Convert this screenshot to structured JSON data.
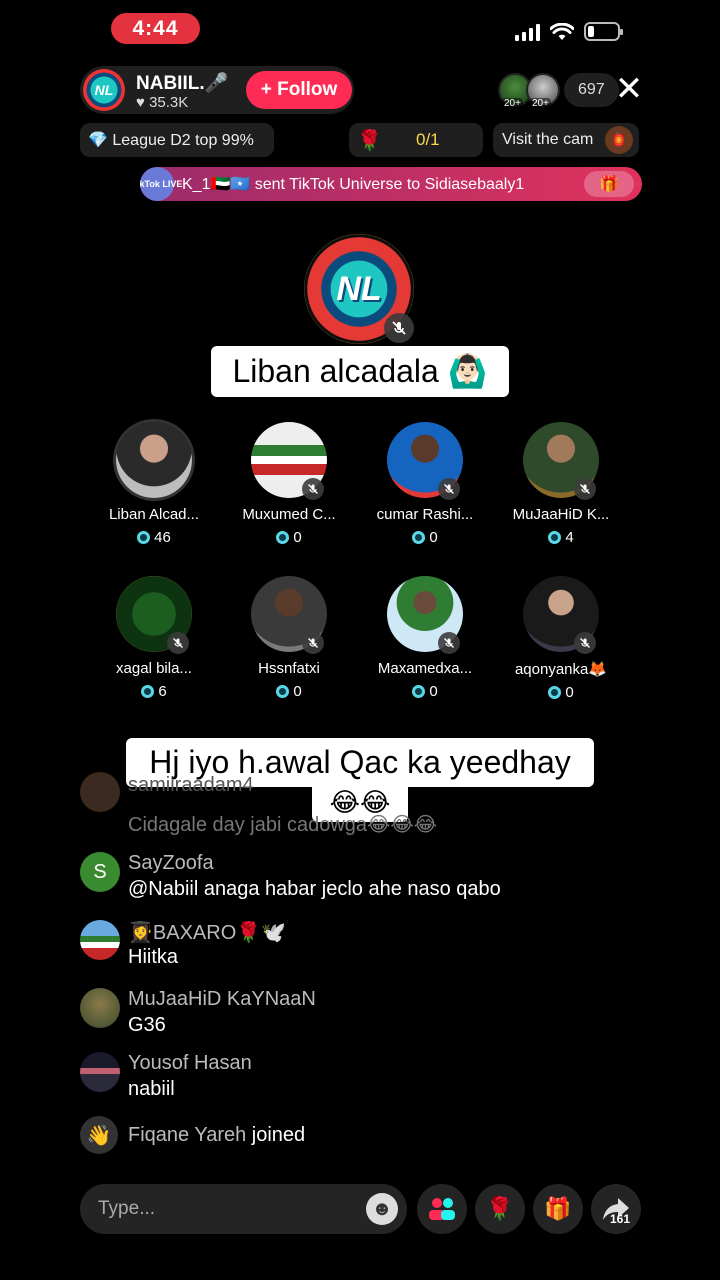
{
  "status_bar": {
    "time": "4:44"
  },
  "host": {
    "avatar_text": "NL",
    "name": "NABIIL.🎤",
    "likes": "♥ 35.3K",
    "follow_label": "+ Follow"
  },
  "viewers": {
    "badges": [
      "20+",
      "20+"
    ],
    "count": "697",
    "close": "✕"
  },
  "info": {
    "league": "💎 League D2 top 99%",
    "goal_icon": "🌹",
    "goal_value": "0/1",
    "cam_label": "Visit the cam"
  },
  "banner": {
    "badge": "TikTok LIVE",
    "text": "K_1🇦🇪🇸🇴 sent TikTok Universe to Sidiasebaaly1",
    "gift_icon": "🎁"
  },
  "main_seat": {
    "logo_text": "NL",
    "caption": "Liban alcadala 🙆🏻‍♂️"
  },
  "guests": [
    {
      "name": "Liban Alcad...",
      "score": "46"
    },
    {
      "name": "Muxumed C...",
      "score": "0"
    },
    {
      "name": "cumar Rashi...",
      "score": "0"
    },
    {
      "name": "MuJaaHiD K...",
      "score": "4"
    },
    {
      "name": "xagal bila...",
      "score": "6"
    },
    {
      "name": "Hssnfatxi",
      "score": "0"
    },
    {
      "name": "Maxamedxa...",
      "score": "0"
    },
    {
      "name": "aqonyanka🦊",
      "score": "0"
    }
  ],
  "overlay_caption": {
    "line1": "Hj iyo h.awal Qac ka yeedhay",
    "line2": "😂😂"
  },
  "comments": [
    {
      "user": "samiiraadam4",
      "text": "Cidagale day jabi cadowga😂😂😂",
      "avatar_letter": ""
    },
    {
      "user": "SayZoofa",
      "text": "@Nabiil anaga habar jeclo ahe naso qabo",
      "avatar_letter": "S"
    },
    {
      "user": "👩‍🎓BAXARO🌹🕊️",
      "text": "Hiitka",
      "avatar_letter": ""
    },
    {
      "user": "MuJaaHiD KaYNaaN",
      "text": "G36",
      "avatar_letter": ""
    },
    {
      "user": "Yousof Hasan",
      "text": "nabiil",
      "avatar_letter": ""
    }
  ],
  "joined": {
    "icon": "👋",
    "user": "Fiqane Yareh",
    "action": "joined"
  },
  "bottom_bar": {
    "placeholder": "Type...",
    "emoji_icon": "☻",
    "share_count": "161"
  },
  "colors": {
    "follow": "#fe2c55",
    "time_pill": "#e5323f",
    "goal_text": "#f7d94c",
    "score_dot": "#5ad7e6"
  }
}
